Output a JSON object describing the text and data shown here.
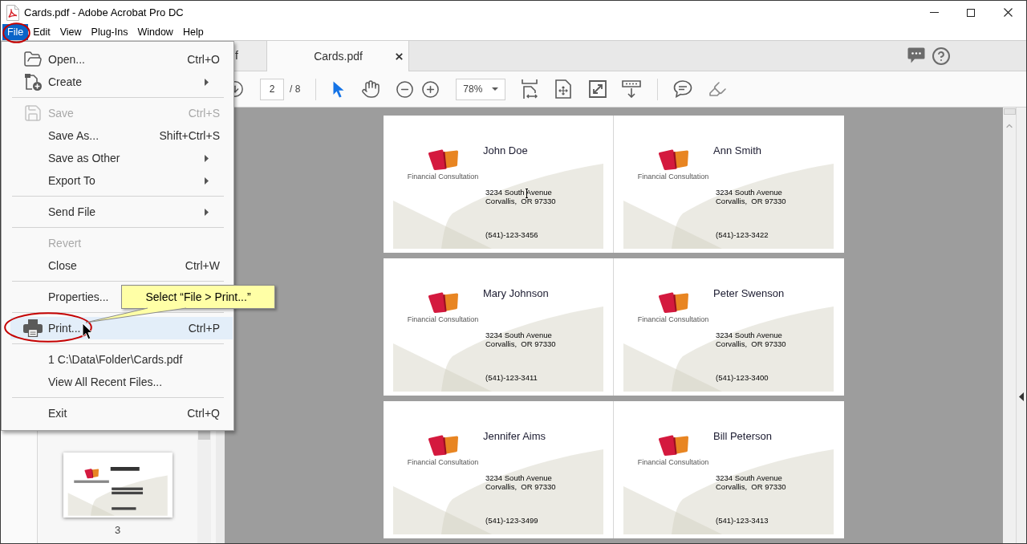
{
  "window": {
    "title": "Cards.pdf - Adobe Acrobat Pro DC"
  },
  "menu_bar": [
    {
      "label": "File",
      "selected": true
    },
    {
      "label": "Edit",
      "selected": false
    },
    {
      "label": "View",
      "selected": false
    },
    {
      "label": "Plug-Ins",
      "selected": false
    },
    {
      "label": "Window",
      "selected": false
    },
    {
      "label": "Help",
      "selected": false
    }
  ],
  "tabs": [
    {
      "label": "f",
      "selected": false
    },
    {
      "label": "Cards.pdf",
      "selected": true
    }
  ],
  "toolbar": {
    "page_number": "2",
    "page_count": "/ 8",
    "select_tool": {
      "selected": true
    },
    "hand_tool": {
      "selected": false
    },
    "zoom": "78%"
  },
  "file_menu": {
    "sections": [
      {
        "items": [
          {
            "label": "Open...",
            "shortcut": "Ctrl+O",
            "submenu": false,
            "disabled": false,
            "selected": false
          },
          {
            "label": "Create",
            "submenu": true,
            "disabled": false,
            "selected": false
          }
        ]
      },
      {
        "items": [
          {
            "label": "Save",
            "shortcut": "Ctrl+S",
            "submenu": false,
            "disabled": true,
            "selected": false
          },
          {
            "label": "Save As...",
            "shortcut": "Shift+Ctrl+S",
            "submenu": false,
            "disabled": false,
            "selected": false
          },
          {
            "label": "Save as Other",
            "submenu": true,
            "disabled": false,
            "selected": false
          },
          {
            "label": "Export To",
            "submenu": true,
            "disabled": false,
            "selected": false
          }
        ]
      },
      {
        "items": [
          {
            "label": "Send File",
            "submenu": true,
            "disabled": false,
            "selected": false
          }
        ]
      },
      {
        "items": [
          {
            "label": "Revert",
            "submenu": false,
            "disabled": true,
            "selected": false
          },
          {
            "label": "Close",
            "shortcut": "Ctrl+W",
            "submenu": false,
            "disabled": false,
            "selected": false
          }
        ]
      },
      {
        "items": [
          {
            "label": "Properties...",
            "submenu": false,
            "disabled": false,
            "selected": false
          }
        ]
      },
      {
        "items": [
          {
            "label": "Print...",
            "shortcut": "Ctrl+P",
            "submenu": false,
            "disabled": false,
            "selected": true
          }
        ]
      },
      {
        "items": [
          {
            "label": "1 C:\\Data\\Folder\\Cards.pdf",
            "submenu": false,
            "disabled": false,
            "selected": false
          },
          {
            "label": "View All Recent Files...",
            "submenu": false,
            "disabled": false,
            "selected": false
          }
        ]
      },
      {
        "items": [
          {
            "label": "Exit",
            "shortcut": "Ctrl+Q",
            "submenu": false,
            "disabled": false,
            "selected": false
          }
        ]
      }
    ]
  },
  "callout": {
    "text": "Select “File > Print...”"
  },
  "thumbnails": [
    {
      "label": "3"
    }
  ],
  "cards": [
    {
      "name": "John Doe",
      "company": "Financial Consultation",
      "address": [
        "3234 South Avenue",
        "Corvallis,  OR 97330"
      ],
      "phone": "(541)-123-3456",
      "text_cursor": true
    },
    {
      "name": "Ann Smith",
      "company": "Financial Consultation",
      "address": [
        "3234 South Avenue",
        "Corvallis,  OR 97330"
      ],
      "phone": "(541)-123-3422"
    },
    {
      "name": "Mary Johnson",
      "company": "Financial Consultation",
      "address": [
        "3234 South Avenue",
        "Corvallis,  OR 97330"
      ],
      "phone": "(541)-123-3411"
    },
    {
      "name": "Peter Swenson",
      "company": "Financial Consultation",
      "address": [
        "3234 South Avenue",
        "Corvallis,  OR 97330"
      ],
      "phone": "(541)-123-3400"
    },
    {
      "name": "Jennifer Aims",
      "company": "Financial Consultation",
      "address": [
        "3234 South Avenue",
        "Corvallis,  OR 97330"
      ],
      "phone": "(541)-123-3499"
    },
    {
      "name": "Bill Peterson",
      "company": "Financial Consultation",
      "address": [
        "3234 South Avenue",
        "Corvallis,  OR 97330"
      ],
      "phone": "(541)-123-3413"
    }
  ]
}
